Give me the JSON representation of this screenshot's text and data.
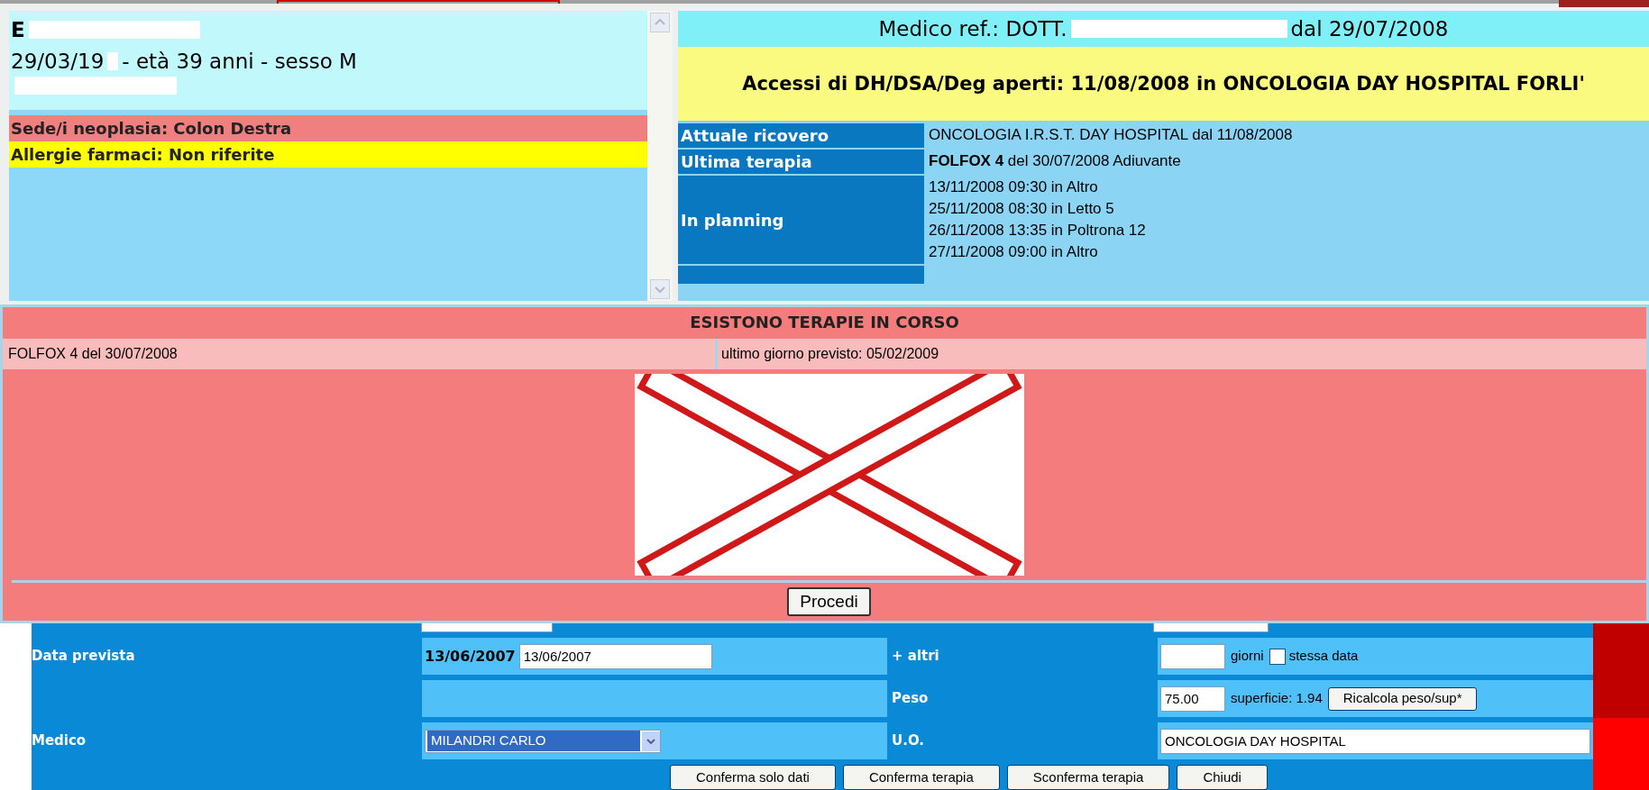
{
  "patient": {
    "name": "E",
    "birth": "29/03/19",
    "details": "- età 39 anni - sesso M"
  },
  "flags": [
    {
      "text": "Sede/i neoplasia: Colon Destra",
      "color": "#f08080"
    },
    {
      "text": "Allergie farmaci: Non riferite",
      "color": "#ffff00"
    }
  ],
  "medico_ref": {
    "prefix": "Medico ref.: DOTT.",
    "suffix": "dal 29/07/2008"
  },
  "accessi": "Accessi di DH/DSA/Deg aperti: 11/08/2008 in ONCOLOGIA DAY HOSPITAL FORLI'",
  "summary": [
    {
      "label": "Attuale ricovero",
      "lines": [
        "ONCOLOGIA I.R.S.T. DAY HOSPITAL dal 11/08/2008"
      ]
    },
    {
      "label": "Ultima terapia",
      "lines": [
        "**FOLFOX 4** del 30/07/2008 Adiuvante"
      ]
    },
    {
      "label": "In planning",
      "lines": [
        "13/11/2008 09:30 in Altro",
        "25/11/2008 08:30 in Letto 5",
        "26/11/2008 13:35 in Poltrona 12",
        "27/11/2008 09:00 in Altro"
      ]
    }
  ],
  "alert": {
    "title": "ESISTONO TERAPIE IN CORSO",
    "therapy": "FOLFOX 4 del 30/07/2008",
    "last_day": "ultimo giorno previsto: 05/02/2009",
    "button": "Procedi"
  },
  "form": {
    "rows": [
      {
        "label": "Data prevista",
        "value": [
          {
            "kind": "bold",
            "text": "13/06/2007"
          },
          {
            "kind": "input",
            "value": "13/06/2007"
          }
        ],
        "label2": "+ altri",
        "value2": [
          {
            "kind": "input"
          },
          {
            "kind": "text",
            "text": "giorni"
          },
          {
            "kind": "checkbox",
            "text": "stessa data",
            "checked": false
          }
        ]
      },
      {
        "value": [],
        "label2": "Peso",
        "value2": [
          {
            "kind": "input",
            "value": "75.00"
          },
          {
            "kind": "text",
            "text": "superficie: 1.94"
          },
          {
            "kind": "button",
            "text": "Ricalcola peso/sup*"
          }
        ]
      },
      {
        "label": "Medico",
        "value": [
          {
            "kind": "select",
            "text": "MILANDRI CARLO",
            "selected": true
          }
        ],
        "label2": "U.O.",
        "value2": [
          {
            "kind": "wideinput",
            "value": "ONCOLOGIA DAY HOSPITAL"
          }
        ]
      }
    ],
    "buttons": [
      "Conferma solo dati",
      "Conferma terapia",
      "Sconferma terapia",
      "Chiudi"
    ]
  }
}
